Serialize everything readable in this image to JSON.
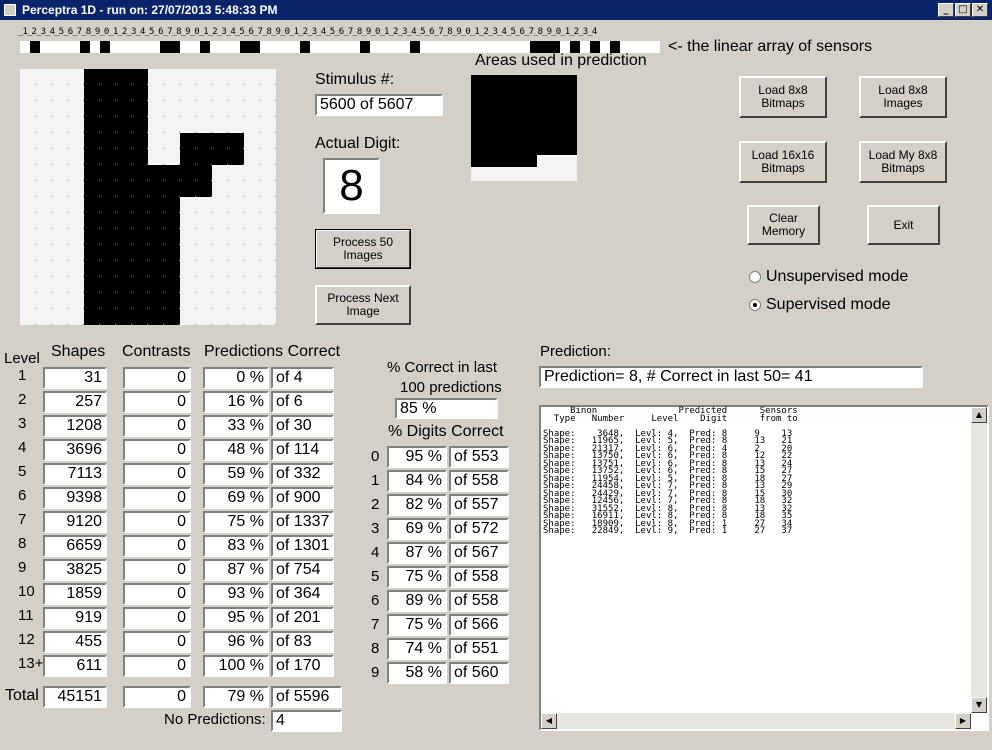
{
  "window": {
    "title": "Perceptra 1D - run on: 27/07/2013  5:48:33 PM"
  },
  "ruler": {
    "digits": "_1_2_3_4_5_6_7_8_9_0_1_2_3_4_5_6_7_8_9_0_1_2_3_4_5_6_7_8_9_0_1_2_3_4_5_6_7_8_9_0_1_2_3_4_5_6_7_8_9_0_1_2_3_4_5_6_7_8_9_0_1_2_3_4",
    "caption": "<- the linear array of sensors"
  },
  "stimulus": {
    "label": "Stimulus #:",
    "value": "5600  of 5607"
  },
  "areas": {
    "label": "Areas used in prediction"
  },
  "actual": {
    "label": "Actual Digit:",
    "value": "8"
  },
  "buttons": {
    "process50": "Process 50 Images",
    "processNext": "Process Next Image",
    "load8x8bitmaps": "Load 8x8 Bitmaps",
    "load8x8images": "Load 8x8 Images",
    "load16x16": "Load 16x16 Bitmaps",
    "loadMy8x8": "Load My 8x8 Bitmaps",
    "clearMemory": "Clear Memory",
    "exit": "Exit"
  },
  "modes": {
    "unsupervised": "Unsupervised mode",
    "supervised": "Supervised mode",
    "selected": "supervised"
  },
  "levels": {
    "headers": {
      "level": "Level",
      "shapes": "Shapes",
      "contrasts": "Contrasts",
      "predictions": "Predictions Correct"
    },
    "rows": [
      {
        "level": "1",
        "shapes": "31",
        "contrasts": "0",
        "pct": "0 %",
        "of": "of 4"
      },
      {
        "level": "2",
        "shapes": "257",
        "contrasts": "0",
        "pct": "16 %",
        "of": "of 6"
      },
      {
        "level": "3",
        "shapes": "1208",
        "contrasts": "0",
        "pct": "33 %",
        "of": "of 30"
      },
      {
        "level": "4",
        "shapes": "3696",
        "contrasts": "0",
        "pct": "48 %",
        "of": "of 114"
      },
      {
        "level": "5",
        "shapes": "7113",
        "contrasts": "0",
        "pct": "59 %",
        "of": "of 332"
      },
      {
        "level": "6",
        "shapes": "9398",
        "contrasts": "0",
        "pct": "69 %",
        "of": "of 900"
      },
      {
        "level": "7",
        "shapes": "9120",
        "contrasts": "0",
        "pct": "75 %",
        "of": "of 1337"
      },
      {
        "level": "8",
        "shapes": "6659",
        "contrasts": "0",
        "pct": "83 %",
        "of": "of 1301"
      },
      {
        "level": "9",
        "shapes": "3825",
        "contrasts": "0",
        "pct": "87 %",
        "of": "of 754"
      },
      {
        "level": "10",
        "shapes": "1859",
        "contrasts": "0",
        "pct": "93 %",
        "of": "of 364"
      },
      {
        "level": "11",
        "shapes": "919",
        "contrasts": "0",
        "pct": "95 %",
        "of": "of 201"
      },
      {
        "level": "12",
        "shapes": "455",
        "contrasts": "0",
        "pct": "96 %",
        "of": "of 83"
      },
      {
        "level": "13+",
        "shapes": "611",
        "contrasts": "0",
        "pct": "100 %",
        "of": "of 170"
      }
    ],
    "total": {
      "label": "Total",
      "shapes": "45151",
      "contrasts": "0",
      "pct": "79 %",
      "of": "of 5596"
    },
    "noPredictions": {
      "label": "No Predictions:",
      "value": "4"
    }
  },
  "last100": {
    "label1": "% Correct in last",
    "label2": "100 predictions",
    "value": "85 %"
  },
  "digits": {
    "label": "% Digits Correct",
    "rows": [
      {
        "digit": "0",
        "pct": "95 %",
        "of": "of 553"
      },
      {
        "digit": "1",
        "pct": "84 %",
        "of": "of 558"
      },
      {
        "digit": "2",
        "pct": "82 %",
        "of": "of 557"
      },
      {
        "digit": "3",
        "pct": "69 %",
        "of": "of 572"
      },
      {
        "digit": "4",
        "pct": "87 %",
        "of": "of 567"
      },
      {
        "digit": "5",
        "pct": "75 %",
        "of": "of 558"
      },
      {
        "digit": "6",
        "pct": "89 %",
        "of": "of 558"
      },
      {
        "digit": "7",
        "pct": "75 %",
        "of": "of 566"
      },
      {
        "digit": "8",
        "pct": "74 %",
        "of": "of 551"
      },
      {
        "digit": "9",
        "pct": "58 %",
        "of": "of 560"
      }
    ]
  },
  "prediction": {
    "label": "Prediction:",
    "value": "Prediction= 8, # Correct in last 50= 41",
    "log": "     Binon               Predicted      Sensors\n  Type   Number     Level    Digit      from to\n\nShape:    3648,  Levl: 4,  Pred: 8     9    13\nShape:   11965,  Levl: 5,  Pred: 8     13   21\nShape:   21317,  Levl: 6,  Pred: 4     2    20\nShape:   13750,  Levl: 6,  Pred: 8     12   22\nShape:   13751,  Levl: 6,  Pred: 8     13   24\nShape:   13752,  Levl: 6,  Pred: 8     15   27\nShape:   11954,  Levl: 5,  Pred: 8     18   27\nShape:   24458,  Levl: 7,  Pred: 8     13   29\nShape:   24429,  Levl: 7,  Pred: 8     15   30\nShape:   12456,  Levl: 7,  Pred: 8     18   32\nShape:   31552,  Levl: 8,  Pred: 8     13   32\nShape:   16911,  Levl: 8,  Pred: 8     18   35\nShape:   18909,  Levl: 8,  Pred: 1     27   34\nShape:   22849,  Levl: 9,  Pred: 1     27   37"
  },
  "colors": {
    "face": "#d4d0c8",
    "titlebar": "#0a246a",
    "pixelOn": "#000000",
    "pixelOff": "#f4f4f4"
  },
  "sensorArray": [
    0,
    1,
    0,
    0,
    0,
    0,
    1,
    0,
    1,
    0,
    0,
    0,
    0,
    0,
    1,
    1,
    0,
    0,
    1,
    0,
    0,
    0,
    1,
    1,
    0,
    0,
    0,
    0,
    1,
    0,
    0,
    0,
    0,
    0,
    1,
    0,
    0,
    0,
    0,
    1,
    0,
    0,
    0,
    0,
    0,
    0,
    0,
    0,
    0,
    0,
    0,
    1,
    1,
    1,
    0,
    1,
    0,
    1,
    0,
    1,
    0,
    0,
    0,
    0
  ],
  "image": [
    [
      0,
      0,
      1,
      1,
      0,
      0,
      0,
      0
    ],
    [
      0,
      0,
      1,
      1,
      0,
      0,
      0,
      0
    ],
    [
      0,
      0,
      1,
      1,
      0,
      1,
      1,
      0
    ],
    [
      0,
      0,
      1,
      1,
      1,
      1,
      0,
      0
    ],
    [
      0,
      0,
      1,
      1,
      1,
      0,
      0,
      0
    ],
    [
      0,
      0,
      1,
      1,
      1,
      0,
      0,
      0
    ],
    [
      0,
      0,
      1,
      1,
      1,
      0,
      0,
      0
    ],
    [
      0,
      0,
      1,
      1,
      1,
      0,
      0,
      0
    ]
  ]
}
